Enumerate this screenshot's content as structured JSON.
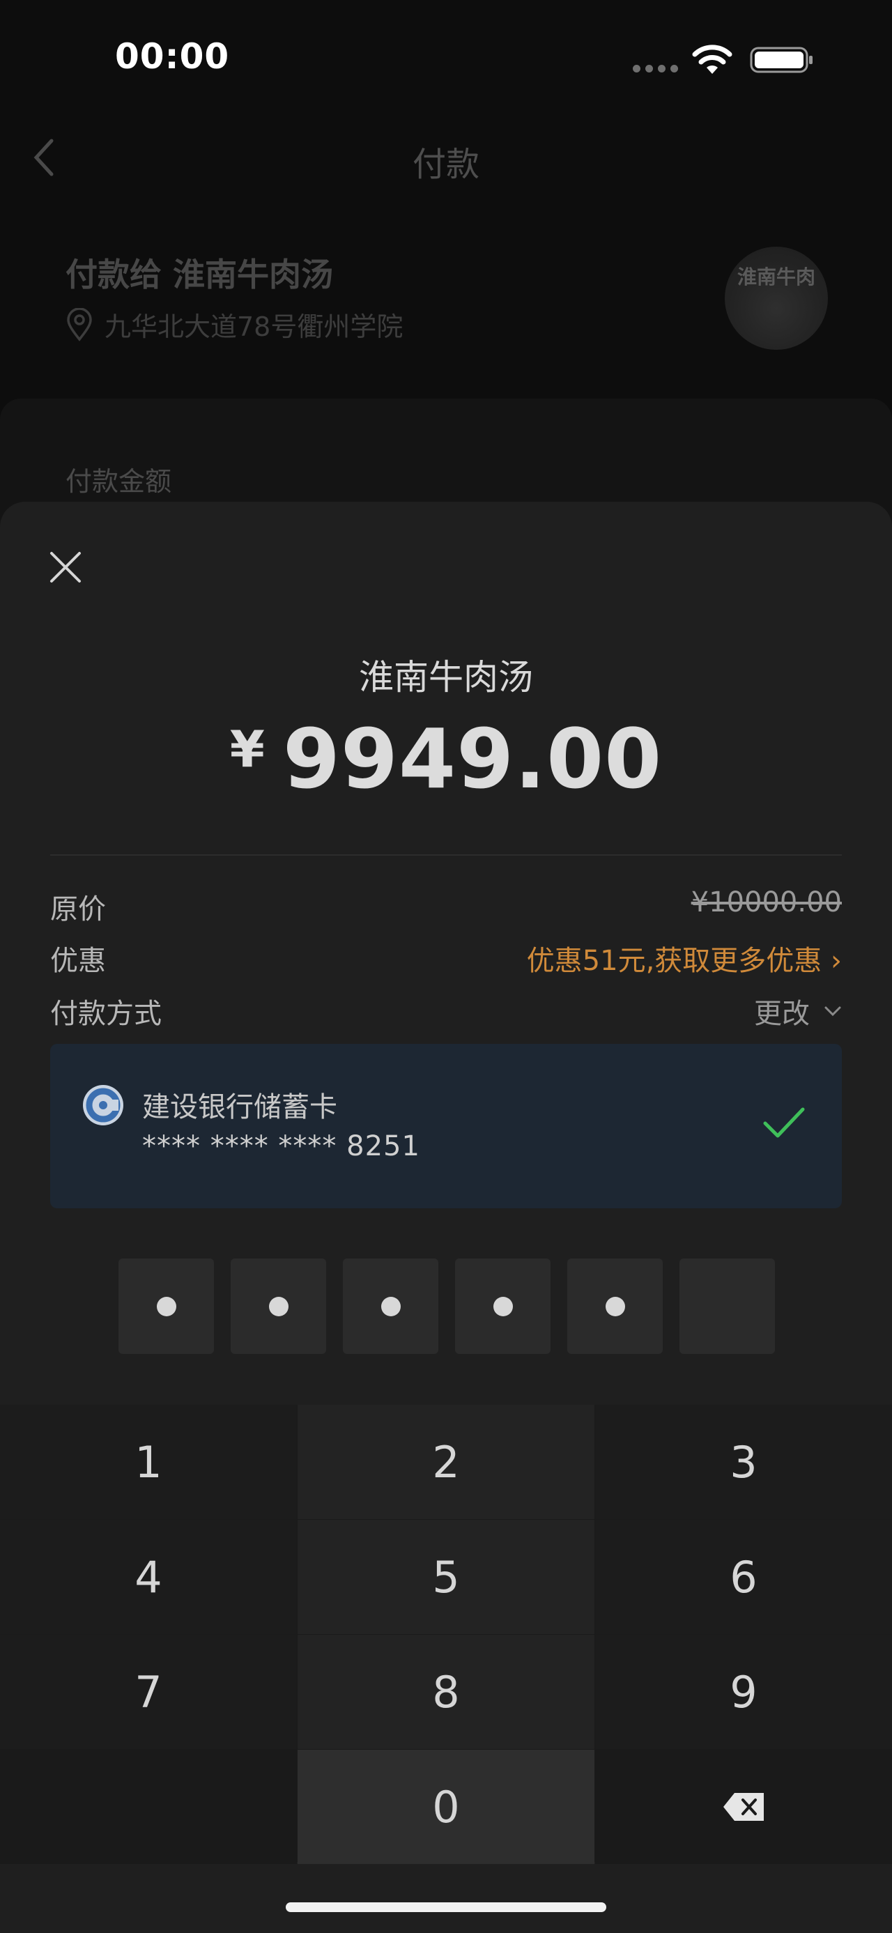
{
  "status_bar": {
    "time": "00:00"
  },
  "nav": {
    "title": "付款"
  },
  "payee": {
    "title": "付款给 淮南牛肉汤",
    "address": "九华北大道78号衢州学院",
    "avatar_sign": "淮南牛肉"
  },
  "background": {
    "amount_label": "付款金额"
  },
  "sheet": {
    "merchant": "淮南牛肉汤",
    "currency": "¥",
    "amount": "9949.00",
    "rows": {
      "original_label": "原价",
      "original_value": "¥10000.00",
      "discount_label": "优惠",
      "discount_value": "优惠51元,获取更多优惠 ›",
      "method_label": "付款方式",
      "method_change": "更改"
    },
    "card": {
      "bank_name": "建设银行储蓄卡",
      "card_number": "**** **** **** 8251"
    },
    "pin": {
      "length": 6,
      "entered": 5
    }
  },
  "keypad": {
    "keys": [
      "1",
      "2",
      "3",
      "4",
      "5",
      "6",
      "7",
      "8",
      "9",
      "0"
    ]
  },
  "colors": {
    "accent_discount": "#d08a3a",
    "check": "#3fbf5a",
    "card_bg": "#1d2733"
  }
}
